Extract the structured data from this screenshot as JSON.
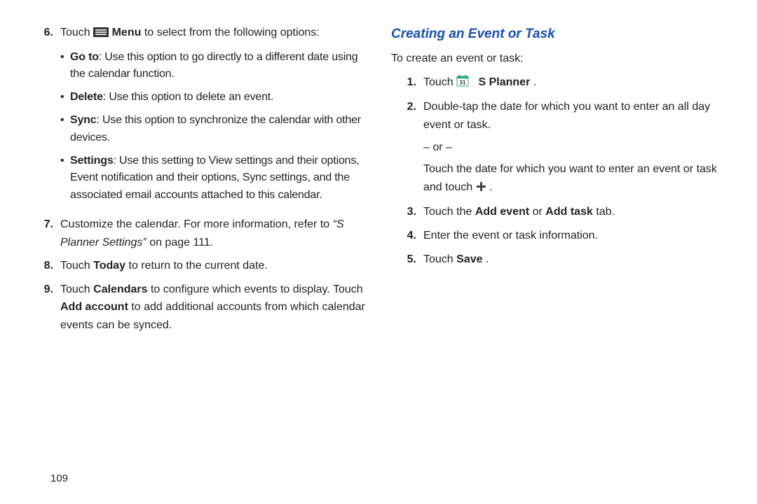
{
  "pageNumber": "109",
  "left": {
    "steps": [
      {
        "n": "6.",
        "prefix": "Touch ",
        "menuWord": "Menu",
        "suffix": " to select from the following options:",
        "bullets": [
          {
            "label": "Go to",
            "text": ": Use this option to go directly to a different date using the calendar function."
          },
          {
            "label": "Delete",
            "text": ": Use this option to delete an event."
          },
          {
            "label": "Sync",
            "text": ": Use this option to synchronize the calendar with other devices."
          },
          {
            "label": "Settings",
            "text": ": Use this setting to View settings and their options, Event notification and their options, Sync settings, and the associated email accounts attached to this calendar."
          }
        ]
      },
      {
        "n": "7.",
        "line1": "Customize the calendar. For more information, refer to ",
        "ref": "“S Planner Settings”",
        "line2": " on page 111."
      },
      {
        "n": "8.",
        "prefix": "Touch ",
        "boldWord": "Today",
        "suffix": " to return to the current date."
      },
      {
        "n": "9.",
        "p1a": "Touch ",
        "p1b": "Calendars",
        "p1c": " to configure which events to display. Touch ",
        "p1d": "Add account",
        "p1e": " to add additional accounts from which calendar events can be synced."
      }
    ]
  },
  "right": {
    "heading": "Creating an Event or Task",
    "intro": "To create an event or task:",
    "steps": [
      {
        "n": "1.",
        "prefix": "Touch ",
        "appName": "S Planner",
        "suffix": "."
      },
      {
        "n": "2.",
        "p1": "Double-tap the date for which you want to enter an all day event or task.",
        "or": "– or –",
        "p2a": "Touch the date for which you want to enter an event or task and touch ",
        "p2b": " ."
      },
      {
        "n": "3.",
        "a": "Touch the ",
        "b": "Add event",
        "c": " or ",
        "d": "Add task",
        "e": " tab."
      },
      {
        "n": "4.",
        "text": "Enter the event or task information."
      },
      {
        "n": "5.",
        "a": "Touch ",
        "b": "Save",
        "c": "."
      }
    ]
  }
}
